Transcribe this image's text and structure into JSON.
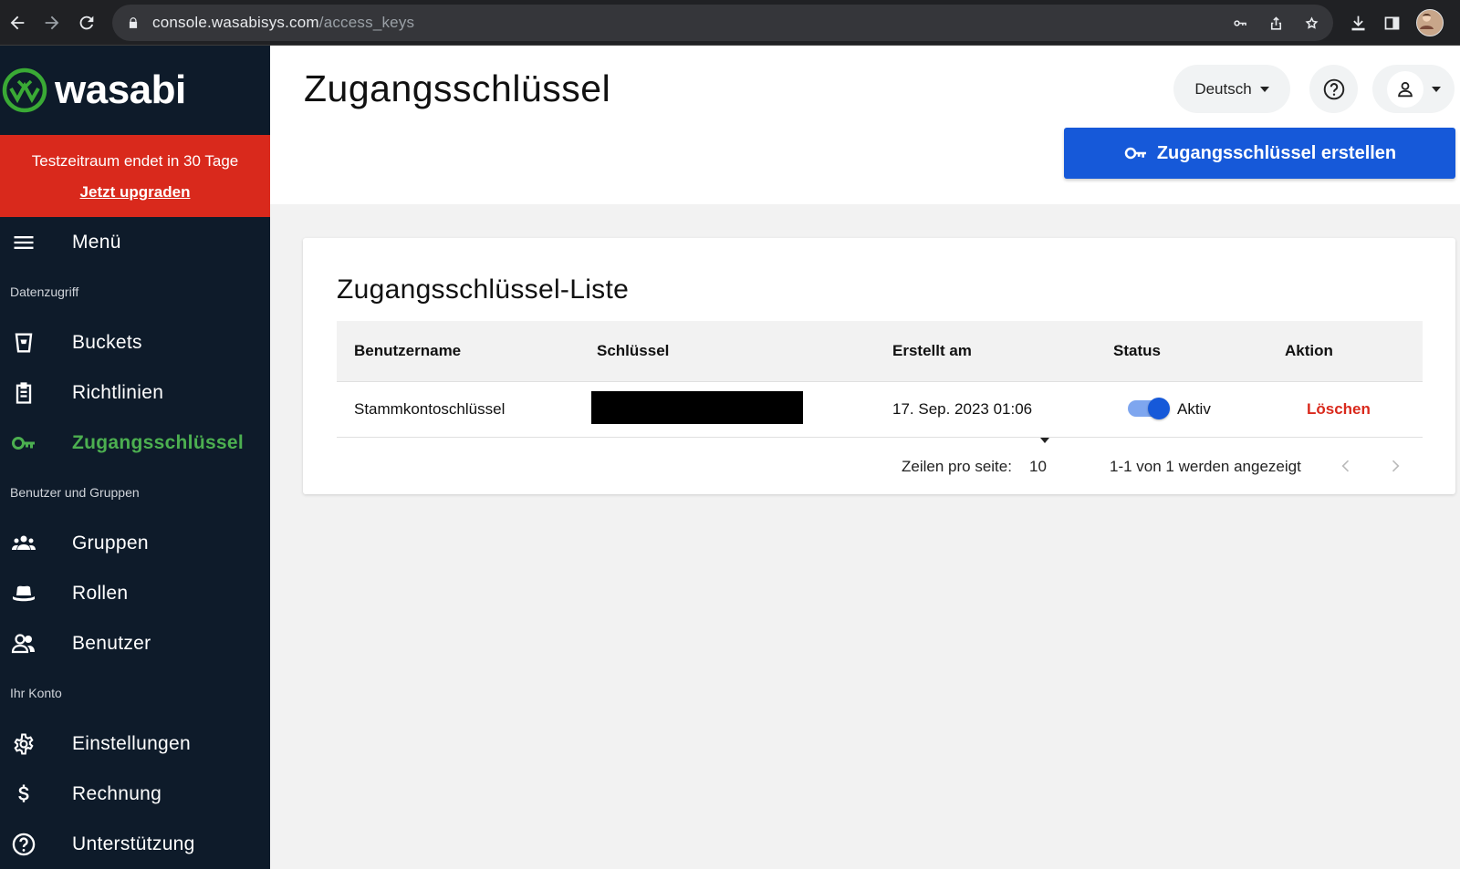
{
  "browser": {
    "url_host": "console.wasabisys.com",
    "url_path": "/access_keys"
  },
  "sidebar": {
    "logo": "wasabi",
    "trial_text": "Testzeitraum endet in 30 Tage",
    "trial_link": "Jetzt upgraden",
    "menu_label": "Menü",
    "sections": [
      {
        "label": "Datenzugriff",
        "items": [
          {
            "label": "Buckets",
            "icon": "bucket-icon"
          },
          {
            "label": "Richtlinien",
            "icon": "clipboard-icon"
          },
          {
            "label": "Zugangsschlüssel",
            "icon": "key-icon",
            "active": true
          }
        ]
      },
      {
        "label": "Benutzer und Gruppen",
        "items": [
          {
            "label": "Gruppen",
            "icon": "groups-icon"
          },
          {
            "label": "Rollen",
            "icon": "hat-icon"
          },
          {
            "label": "Benutzer",
            "icon": "users-icon"
          }
        ]
      },
      {
        "label": "Ihr Konto",
        "items": [
          {
            "label": "Einstellungen",
            "icon": "gear-icon"
          },
          {
            "label": "Rechnung",
            "icon": "dollar-icon"
          },
          {
            "label": "Unterstützung",
            "icon": "help-icon"
          }
        ]
      }
    ]
  },
  "header": {
    "title": "Zugangsschlüssel",
    "language": "Deutsch",
    "create_button": "Zugangsschlüssel erstellen"
  },
  "card": {
    "title": "Zugangsschlüssel-Liste",
    "columns": [
      "Benutzername",
      "Schlüssel",
      "Erstellt am",
      "Status",
      "Aktion"
    ],
    "rows": [
      {
        "username": "Stammkontoschlüssel",
        "key": "",
        "created": "17. Sep. 2023 01:06",
        "status": "Aktiv",
        "action": "Löschen"
      }
    ],
    "pagination": {
      "rows_per_page_label": "Zeilen pro seite:",
      "rows_per_page": "10",
      "range_text": "1-1 von 1 werden angezeigt"
    }
  },
  "colors": {
    "sidebar_bg": "#0e1b2a",
    "accent_green": "#4caf50",
    "primary_blue": "#1659d9",
    "danger_red": "#d9291c"
  }
}
